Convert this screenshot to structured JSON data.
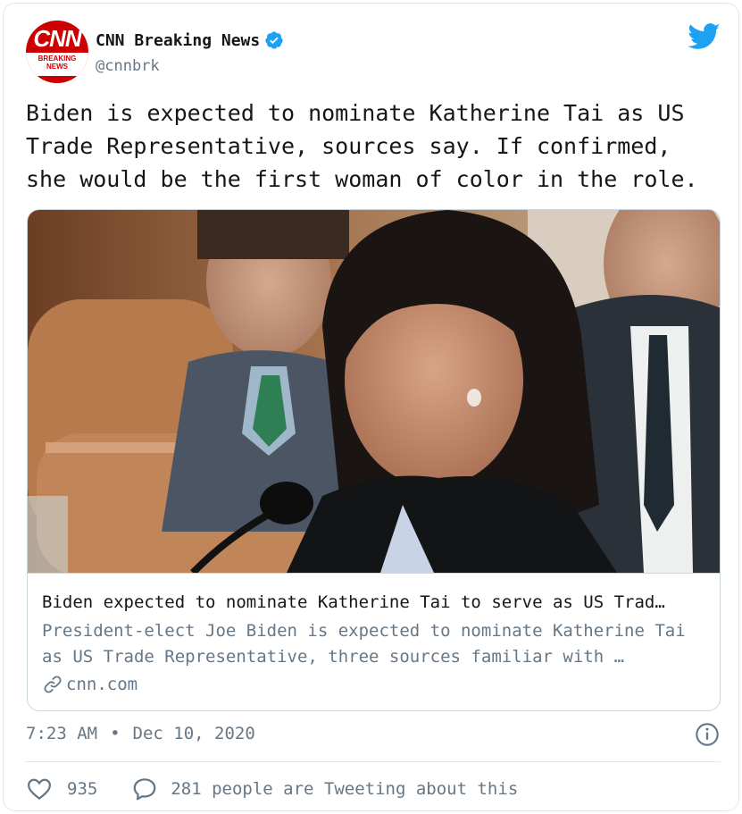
{
  "author": {
    "display_name": "CNN Breaking News",
    "handle": "@cnnbrk",
    "avatar_logo": "CNN",
    "avatar_strip_line1": "BREAKING",
    "avatar_strip_line2": "NEWS",
    "verified": true
  },
  "tweet": {
    "text": "Biden is expected to nominate Katherine Tai as US Trade Representative, sources say. If confirmed, she would be the first woman of color in the role."
  },
  "link_card": {
    "title": "Biden expected to nominate Katherine Tai to serve as US Trad…",
    "description": "President-elect Joe Biden is expected to nominate Katherine Tai as US Trade Representative, three sources familiar with …",
    "domain": "cnn.com"
  },
  "meta": {
    "time": "7:23 AM",
    "separator": "•",
    "date": "Dec 10, 2020"
  },
  "engagement": {
    "likes": "935",
    "tweeting": "281 people are Tweeting about this"
  },
  "colors": {
    "brand_blue": "#1da1f2",
    "cnn_red": "#cc0000",
    "secondary_text": "#657786",
    "border": "#e1e8ed"
  },
  "icons": [
    "verified-badge-icon",
    "twitter-bird-icon",
    "link-icon",
    "info-icon",
    "heart-icon",
    "reply-bubble-icon"
  ]
}
